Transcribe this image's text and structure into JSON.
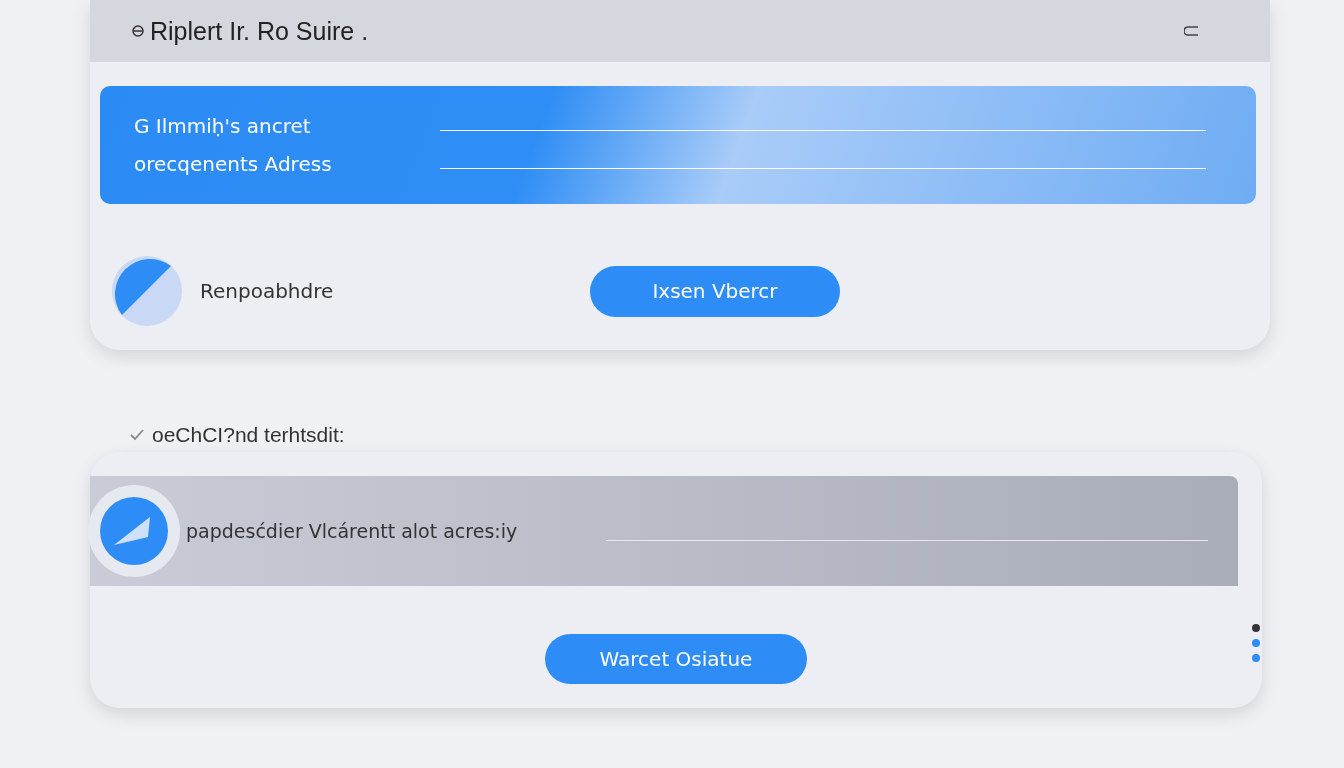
{
  "header": {
    "title": "Riplert Ir. Ro Suire ."
  },
  "form": {
    "fields": [
      {
        "label": "G Ilmmiḥ's ancret"
      },
      {
        "label": "orecqenents Adress"
      }
    ]
  },
  "profile": {
    "name": "Renpoabhdre",
    "button": "Ixsen Vbercr"
  },
  "section": {
    "heading": "oeChCI?nd terhtsdit:",
    "field": {
      "label": "papdesćdier Vlcárentt alot acres:iy"
    },
    "button": "Warcet Osiatue"
  },
  "pager": [
    {
      "selected": true
    },
    {
      "selected": false
    },
    {
      "selected": false
    }
  ]
}
